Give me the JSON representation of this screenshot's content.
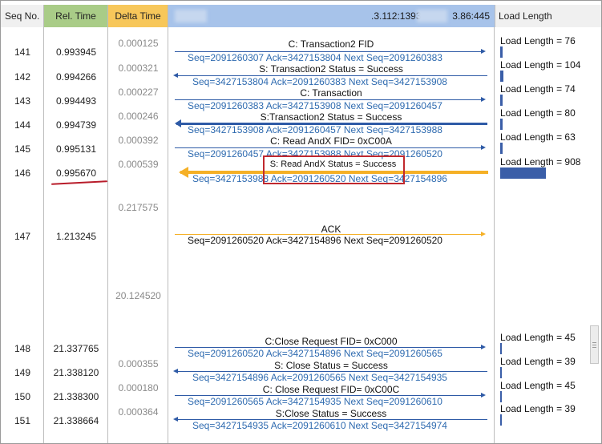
{
  "headers": {
    "seq": "Seq No.",
    "rel": "Rel. Time",
    "delta": "Delta Time",
    "host_left": ".3.112:1393",
    "host_right": "3.86:445",
    "load": "Load Length"
  },
  "rows": [
    {
      "seq": "141",
      "rel": "0.993945",
      "delta": "0.000125",
      "label": "C: Transaction2 FID",
      "detail": "Seq=2091260307  Ack=3427153804  Next Seq=2091260383",
      "direction": "right",
      "load": "Load Length = 76",
      "load_value": 76
    },
    {
      "seq": "142",
      "rel": "0.994266",
      "delta": "0.000321",
      "label": "S: Transaction2 Status = Success",
      "detail": "Seq=3427153804  Ack=2091260383  Next Seq=3427153908",
      "direction": "left",
      "load": "Load Length = 104",
      "load_value": 104
    },
    {
      "seq": "143",
      "rel": "0.994493",
      "delta": "0.000227",
      "label": "C: Transaction",
      "detail": "Seq=2091260383  Ack=3427153908  Next Seq=2091260457",
      "direction": "right",
      "load": "Load Length = 74",
      "load_value": 74
    },
    {
      "seq": "144",
      "rel": "0.994739",
      "delta": "0.000246",
      "label": "S:Transaction2 Status = Success",
      "detail": "Seq=3427153908  Ack=2091260457  Next Seq=3427153988",
      "direction": "left",
      "load": "Load Length = 80",
      "load_value": 80
    },
    {
      "seq": "145",
      "rel": "0.995131",
      "delta": "0.000392",
      "label": "C: Read AndX  FID= 0xC00A",
      "detail": "Seq=2091260457  Ack=3427153988  Next Seq=2091260520",
      "direction": "right",
      "load": "Load Length = 63",
      "load_value": 63
    },
    {
      "seq": "146",
      "rel": "0.995670",
      "delta": "0.000539",
      "label": "S: Read AndX  Status = Success",
      "detail": "Seq=3427153988  Ack=2091260520  Next Seq=3427154896",
      "direction": "left",
      "load": "Load Length = 908",
      "load_value": 908
    },
    {
      "seq": "147",
      "rel": "1.213245",
      "delta": "0.217575",
      "label": "ACK",
      "detail": "Seq=2091260520  Ack=3427154896  Next Seq=2091260520",
      "direction": "right",
      "load": "",
      "load_value": 0
    },
    {
      "seq": "148",
      "rel": "21.337765",
      "delta": "20.124520",
      "label": "C:Close Request FID=  0xC000",
      "detail": "Seq=2091260520  Ack=3427154896  Next Seq=2091260565",
      "direction": "right",
      "load": "Load Length = 45",
      "load_value": 45
    },
    {
      "seq": "149",
      "rel": "21.338120",
      "delta": "0.000355",
      "label": "S: Close Status = Success",
      "detail": "Seq=3427154896  Ack=2091260565  Next Seq=3427154935",
      "direction": "left",
      "load": "Load Length = 39",
      "load_value": 39
    },
    {
      "seq": "150",
      "rel": "21.338300",
      "delta": "0.000180",
      "label": "C: Close Request FID=  0xC00C",
      "detail": "Seq=2091260565  Ack=3427154935  Next Seq=2091260610",
      "direction": "right",
      "load": "Load Length = 45",
      "load_value": 45
    },
    {
      "seq": "151",
      "rel": "21.338664",
      "delta": "0.000364",
      "label": "S:Close Status = Success",
      "detail": "Seq=3427154935  Ack=2091260610  Next Seq=3427154974",
      "direction": "left",
      "load": "Load Length = 39",
      "load_value": 39
    }
  ],
  "colors": {
    "rel_header": "#a9cc87",
    "delta_header": "#f7c75a",
    "hosts_header": "#a7c3ea",
    "arrow": "#2e5aa6",
    "highlight_arrow": "#f5b026",
    "annotation": "#c0282e"
  }
}
